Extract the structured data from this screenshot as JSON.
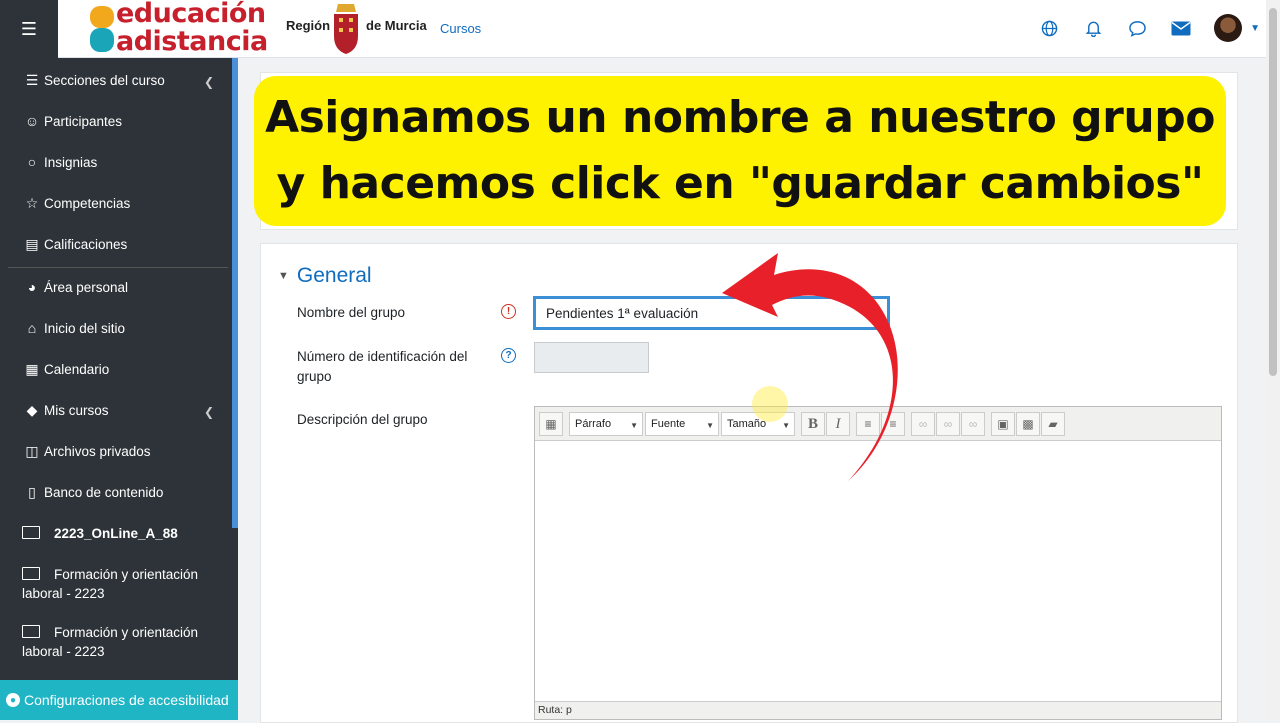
{
  "topbar": {
    "logo_line1": "educación",
    "logo_line2": "adistancia",
    "region_left": "Región",
    "region_right": "de Murcia",
    "cursos_link": "Cursos",
    "icons": [
      "hamburger-icon",
      "globe-icon",
      "bell-icon",
      "chat-icon",
      "envelope-icon",
      "avatar",
      "caret-down-icon"
    ]
  },
  "sidebar": {
    "items": [
      {
        "label": "Secciones del curso",
        "icon": "list-icon"
      },
      {
        "label": "Participantes",
        "icon": "users-icon"
      },
      {
        "label": "Insignias",
        "icon": "badge-icon"
      },
      {
        "label": "Competencias",
        "icon": "star-icon"
      },
      {
        "label": "Calificaciones",
        "icon": "grades-icon"
      },
      {
        "label": "Área personal",
        "icon": "dashboard-icon"
      },
      {
        "label": "Inicio del sitio",
        "icon": "home-icon"
      },
      {
        "label": "Calendario",
        "icon": "calendar-icon"
      },
      {
        "label": "Mis cursos",
        "icon": "mortarboard-icon"
      },
      {
        "label": "Archivos privados",
        "icon": "files-icon"
      },
      {
        "label": "Banco de contenido",
        "icon": "clipboard-icon"
      }
    ],
    "folders": [
      {
        "label": "2223_OnLine_A_88"
      },
      {
        "label": "Formación y orientación laboral - 2223"
      },
      {
        "label": "Formación y orientación laboral - 2223"
      }
    ],
    "accessibility_label": "Configuraciones de accesibilidad"
  },
  "banner": {
    "line1": "Asignamos un nombre a nuestro grupo",
    "line2": "y hacemos click en \"guardar cambios\""
  },
  "form": {
    "section_title": "General",
    "name_label": "Nombre del grupo",
    "name_value": "Pendientes 1ª evaluación",
    "idnumber_label_1": "Número de identificación del",
    "idnumber_label_2": "grupo",
    "idnumber_value": "",
    "description_label": "Descripción del grupo",
    "editor": {
      "format_select": "Párrafo",
      "font_select": "Fuente",
      "size_select": "Tamaño",
      "status_path": "Ruta: p"
    }
  },
  "colors": {
    "sidebar_bg": "#2d3338",
    "accent_blue": "#0f6cbf",
    "banner_yellow": "#fff200",
    "arrow_red": "#e8202a",
    "accessibility_teal": "#1fb5c4"
  }
}
